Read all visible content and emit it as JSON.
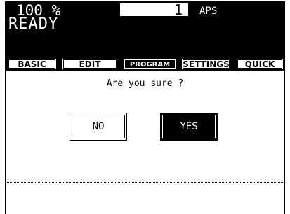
{
  "status": {
    "zoom": "100 %",
    "copies": "1",
    "paper_mode": "APS",
    "machine_status": "READY"
  },
  "tabs": [
    {
      "label": "BASIC",
      "active": false
    },
    {
      "label": "EDIT",
      "active": false
    },
    {
      "label": "PROGRAM",
      "active": true
    },
    {
      "label": "SETTINGS",
      "active": false
    },
    {
      "label": "QUICK",
      "active": false
    }
  ],
  "dialog": {
    "prompt": "Are you sure ?",
    "no_label": "NO",
    "yes_label": "YES",
    "message": ""
  },
  "colors": {
    "foreground": "#000000",
    "background": "#ffffff"
  }
}
